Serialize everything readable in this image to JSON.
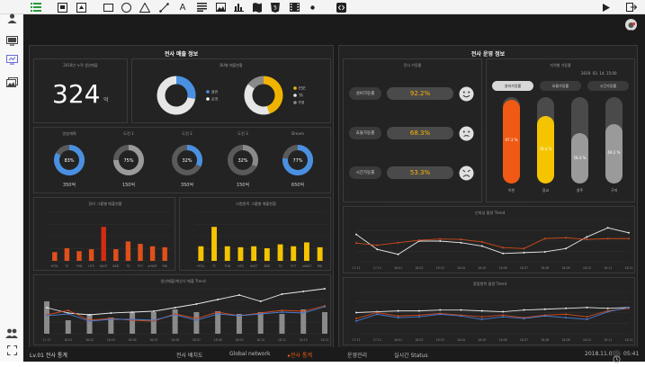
{
  "toolbar": {
    "tools": [
      "list-view",
      "image-frame",
      "image-frame",
      "rectangle",
      "circle",
      "triangle",
      "line",
      "text",
      "paragraph",
      "image",
      "bar-chart",
      "map",
      "html5",
      "video",
      "dot",
      "code"
    ],
    "right_tools": [
      "play",
      "exit"
    ]
  },
  "rail": [
    "user",
    "screen",
    "images",
    "group",
    "fullscreen"
  ],
  "sales": {
    "title": "전사 매출 정보",
    "cumulative": {
      "title": "2018년 누적 생산매출",
      "value": "324",
      "unit": "억"
    },
    "bu_donuts": {
      "title": "BU별 매출현황",
      "donut1": {
        "legend": [
          "물류",
          "운영"
        ],
        "values": [
          28,
          72
        ],
        "colors": [
          "#4a90e2",
          "#e6e6e6"
        ]
      },
      "donut2": {
        "legend": [
          "ESE",
          "TA",
          "FIB"
        ],
        "values": [
          45,
          40,
          15
        ],
        "colors": [
          "#f0b400",
          "#e6e6e6",
          "#8a8a8a"
        ]
      }
    },
    "plans": {
      "items": [
        {
          "label": "경영계획",
          "pct": "83%",
          "value": "350억",
          "fraction": 0.83,
          "color": "#4a90e2"
        },
        {
          "label": "도전 1",
          "pct": "75%",
          "value": "150억",
          "fraction": 0.75,
          "color": "#9a9a9a"
        },
        {
          "label": "도전 2",
          "pct": "32%",
          "value": "350억",
          "fraction": 0.32,
          "color": "#4a90e2"
        },
        {
          "label": "도전 3",
          "pct": "32%",
          "value": "150억",
          "fraction": 0.32,
          "color": "#8a8a8a"
        },
        {
          "label": "Dream",
          "pct": "77%",
          "value": "650억",
          "fraction": 0.77,
          "color": "#4a90e2"
        }
      ]
    }
  },
  "ops": {
    "title": "전사 운영 정보",
    "rates_title": "전사 가동률",
    "rates": [
      {
        "label": "설비가동률",
        "value": "92.2%",
        "face": "happy"
      },
      {
        "label": "효율가동률",
        "value": "68.3%",
        "face": "neutral"
      },
      {
        "label": "시간가동률",
        "value": "53.3%",
        "face": "sad"
      }
    ],
    "regional": {
      "title": "지역별 가동률",
      "date": "2019. 03. 14. 15:00",
      "tabs": [
        "설비가동률",
        "효율가동률",
        "시간가동률"
      ],
      "bars": [
        {
          "name": "이천",
          "value": 97.2,
          "label": "97.3 %",
          "color": "#f05a14"
        },
        {
          "name": "광교",
          "value": 78.4,
          "label": "78.4 %",
          "color": "#f5c400"
        },
        {
          "name": "청주",
          "value": 58.4,
          "label": "58.4 %",
          "color": "#9a9a9a"
        },
        {
          "name": "구미",
          "value": 69.2,
          "label": "69.2 %",
          "color": "#9a9a9a"
        }
      ]
    }
  },
  "chart_data": [
    {
      "type": "bar",
      "title": "장비 그룹별 매출현황",
      "categories": [
        "HTSL",
        "TC",
        "THB",
        "HTS",
        "HAST",
        "BKD",
        "TS",
        "PCT",
        "uHAST",
        "RBI"
      ],
      "values": [
        18,
        26,
        20,
        24,
        70,
        24,
        40,
        35,
        30,
        28
      ],
      "colors": [
        "#e0501a",
        "#e0501a",
        "#e0501a",
        "#e0501a",
        "#d02d14",
        "#e0501a",
        "#e0501a",
        "#e0501a",
        "#e0501a",
        "#e0501a"
      ]
    },
    {
      "type": "bar",
      "title": "시험항목 그룹별 매출현황",
      "categories": [
        "HTSL",
        "TC",
        "THB",
        "HTS",
        "HAST",
        "BKD",
        "TS",
        "PCT",
        "uHAST",
        "RBI"
      ],
      "values": [
        30,
        70,
        30,
        28,
        30,
        26,
        34,
        30,
        38,
        28
      ],
      "colors": [
        "#f5c400",
        "#f5c400",
        "#f5c400",
        "#f5c400",
        "#f5c400",
        "#f5c400",
        "#f5c400",
        "#f5c400",
        "#f5c400",
        "#f5c400"
      ]
    },
    {
      "type": "line",
      "title": "신뢰성 물량 Trend",
      "categories": [
        "17.11",
        "17.12",
        "18.01",
        "18.02",
        "18.03",
        "18.04",
        "18.05",
        "18.06",
        "18.07",
        "18.08",
        "18.09",
        "18.10",
        "18.11",
        "18.12"
      ],
      "series": [
        {
          "values": [
            66,
            30,
            18,
            50,
            50,
            46,
            38,
            20,
            22,
            24,
            32,
            60,
            82,
            70
          ],
          "color": "#e8e8e8"
        },
        {
          "values": [
            45,
            40,
            46,
            52,
            55,
            54,
            48,
            34,
            32,
            56,
            58,
            54,
            56,
            56
          ],
          "color": "#d04a1c"
        }
      ],
      "ylim": [
        0,
        100
      ]
    },
    {
      "type": "line+bar",
      "title": "생산매출/계산식 매출 Trend",
      "categories": [
        "17.12",
        "18.01",
        "18.02",
        "18.03",
        "18.04",
        "18.05",
        "18.06",
        "18.07",
        "18.08",
        "18.09",
        "18.10",
        "18.11",
        "18.12",
        "18.12"
      ],
      "bars": [
        72,
        30,
        44,
        36,
        48,
        48,
        54,
        48,
        50,
        44,
        48,
        44,
        54,
        48
      ],
      "series": [
        {
          "values": [
            58,
            46,
            42,
            46,
            48,
            50,
            58,
            66,
            76,
            86,
            72,
            88,
            94,
            100
          ],
          "color": "#e8e8e8"
        },
        {
          "values": [
            42,
            52,
            30,
            34,
            30,
            28,
            44,
            34,
            48,
            40,
            46,
            52,
            50,
            62
          ],
          "color": "#d04a1c"
        },
        {
          "values": [
            40,
            44,
            28,
            32,
            32,
            30,
            42,
            30,
            44,
            40,
            44,
            48,
            46,
            60
          ],
          "color": "#4a7bd0"
        }
      ],
      "ylim": [
        0,
        100
      ]
    },
    {
      "type": "line",
      "title": "종합항목 물량 Trend",
      "categories": [
        "17.11",
        "17.12",
        "18.01",
        "18.02",
        "18.03",
        "18.04",
        "18.05",
        "18.06",
        "18.07",
        "18.08",
        "18.09",
        "18.10",
        "18.11",
        "18.12"
      ],
      "series": [
        {
          "values": [
            50,
            52,
            54,
            54,
            56,
            56,
            54,
            52,
            56,
            58,
            60,
            62,
            60,
            62
          ],
          "color": "#e8e8e8"
        },
        {
          "values": [
            36,
            50,
            42,
            44,
            48,
            44,
            40,
            44,
            38,
            44,
            46,
            40,
            54,
            60
          ],
          "color": "#d04a1c"
        },
        {
          "values": [
            30,
            46,
            38,
            40,
            46,
            42,
            34,
            40,
            36,
            42,
            38,
            34,
            52,
            62
          ],
          "color": "#4a7bd0"
        }
      ],
      "ylim": [
        0,
        100
      ]
    }
  ],
  "bottom": {
    "left_title": "Lv.01 전사 통계",
    "tabs": [
      "전사 배치도",
      "Global network",
      "▸전사 통계",
      "운영관리",
      "실시간 Status"
    ],
    "active_tab_color": "#f05a14",
    "date": "2018.11.01",
    "time": "05:41"
  }
}
